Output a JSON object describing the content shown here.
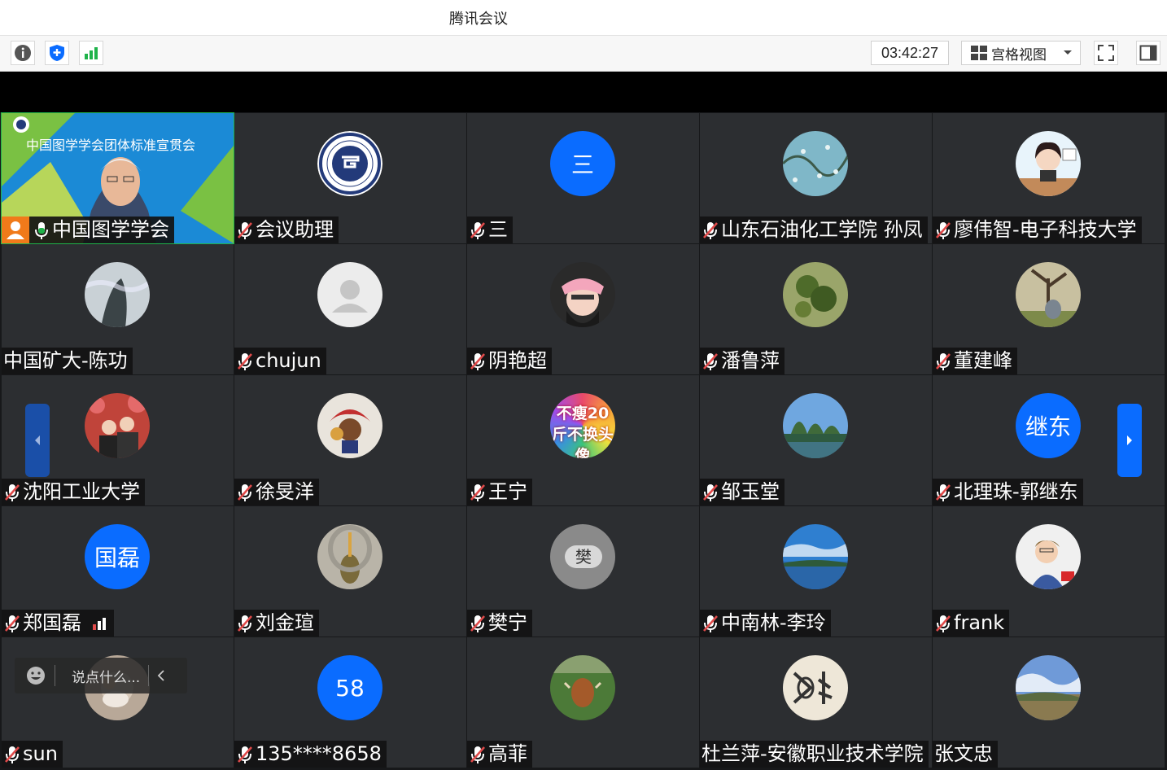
{
  "window": {
    "title": "腾讯会议"
  },
  "toolbar": {
    "timer": "03:42:27",
    "view_label": "宫格视图"
  },
  "colors": {
    "accent": "#0a6cff",
    "tile_bg": "#2c2e31",
    "muted_mic": "#e04a4a"
  },
  "participants": [
    {
      "name": "中国图学学会",
      "avatar": "video",
      "mic": "on"
    },
    {
      "name": "会议助理",
      "avatar": "logo",
      "mic": "muted"
    },
    {
      "name": "三",
      "avatar": "text",
      "avatar_text": "三",
      "mic": "muted"
    },
    {
      "name": "山东石油化工学院 孙凤",
      "avatar": "photo",
      "mic": "muted"
    },
    {
      "name": "廖伟智-电子科技大学",
      "avatar": "photo",
      "mic": "muted"
    },
    {
      "name": "中国矿大-陈功",
      "avatar": "photo",
      "mic": "none"
    },
    {
      "name": "chujun",
      "avatar": "default",
      "mic": "muted"
    },
    {
      "name": "阴艳超",
      "avatar": "photo",
      "mic": "muted"
    },
    {
      "name": "潘鲁萍",
      "avatar": "photo",
      "mic": "muted"
    },
    {
      "name": "董建峰",
      "avatar": "photo",
      "mic": "muted"
    },
    {
      "name": "沈阳工业大学",
      "avatar": "photo",
      "mic": "muted"
    },
    {
      "name": "徐旻洋",
      "avatar": "photo",
      "mic": "muted"
    },
    {
      "name": "王宁",
      "avatar": "photo",
      "mic": "muted"
    },
    {
      "name": "邹玉堂",
      "avatar": "photo",
      "mic": "muted"
    },
    {
      "name": "北理珠-郭继东",
      "avatar": "text",
      "avatar_text": "继东",
      "mic": "muted"
    },
    {
      "name": "郑国磊",
      "avatar": "text",
      "avatar_text": "国磊",
      "mic": "muted",
      "signal": true
    },
    {
      "name": "刘金瑄",
      "avatar": "photo",
      "mic": "muted"
    },
    {
      "name": "樊宁",
      "avatar": "photo",
      "mic": "muted"
    },
    {
      "name": "中南林-李玲",
      "avatar": "photo",
      "mic": "muted"
    },
    {
      "name": "frank",
      "avatar": "photo",
      "mic": "muted"
    },
    {
      "name": "sun",
      "avatar": "photo",
      "mic": "muted"
    },
    {
      "name": "135****8658",
      "avatar": "text",
      "avatar_text": "58",
      "mic": "muted"
    },
    {
      "name": "高菲",
      "avatar": "photo",
      "mic": "muted"
    },
    {
      "name": "杜兰萍-安徽职业技术学院",
      "avatar": "photo",
      "mic": "none"
    },
    {
      "name": "张文忠",
      "avatar": "photo",
      "mic": "none"
    }
  ],
  "video": {
    "banner_text": "中国图学学会团体标准宣贯会"
  },
  "logo_text": "中国图学学会",
  "avatar_texts": {
    "san": "三",
    "jidong": "继东",
    "guolei": "国磊",
    "n58": "58",
    "wangning": "不瘦20斤不换头像",
    "fanning": "樊"
  },
  "chat": {
    "placeholder": "说点什么..."
  }
}
